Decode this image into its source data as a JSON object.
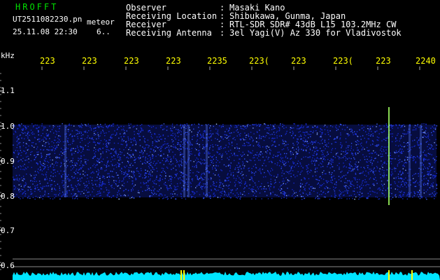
{
  "app": {
    "name": "HROFFT",
    "file_name": "UT2511082230.pn",
    "subtitle": "meteor",
    "datetime": "25.11.08 22:30",
    "page": "6.."
  },
  "info": {
    "rows": [
      {
        "label": "Observer",
        "value": "Masaki Kano"
      },
      {
        "label": "Receiving Location",
        "value": "Shibukawa, Gunma, Japan"
      },
      {
        "label": "Receiver",
        "value": "RTL-SDR SDR# 43dB L15 103.2MHz CW"
      },
      {
        "label": "Receiving Antenna",
        "value": "3el Yagi(V) Az 330 for Vladivostok"
      }
    ],
    "separator": ":"
  },
  "axis": {
    "y_unit": "kHz",
    "y_ticks": [
      "1.1",
      "1.0",
      "0.9",
      "0.8",
      "0.7",
      "0.6"
    ],
    "x_ticks": [
      "223",
      "223",
      "223",
      "223",
      "2235",
      "223(",
      "223",
      "223(",
      "223",
      "2240"
    ]
  },
  "colors": {
    "background": "#000000",
    "header_text": "#ffffff",
    "app_name": "#00e000",
    "tick_labels": "#ffff00",
    "spectrum_band": "#1a2ee0",
    "noise_floor": "#00e5ff",
    "meteor_echo": "#ffff00"
  }
}
